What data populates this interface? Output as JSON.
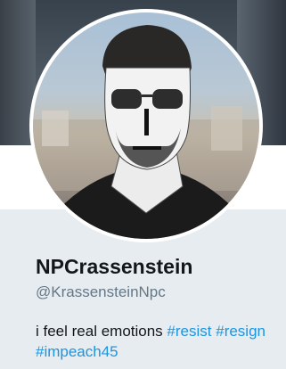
{
  "profile": {
    "display_name": "NPCrassenstein",
    "handle": "@KrassensteinNpc",
    "bio_text": "i feel real emotions",
    "hashtags": [
      "#resist",
      "#resign",
      "#impeach45"
    ]
  },
  "colors": {
    "background": "#e6ecf0",
    "name": "#14171a",
    "handle": "#657786",
    "hashtag": "#1b95e0"
  }
}
